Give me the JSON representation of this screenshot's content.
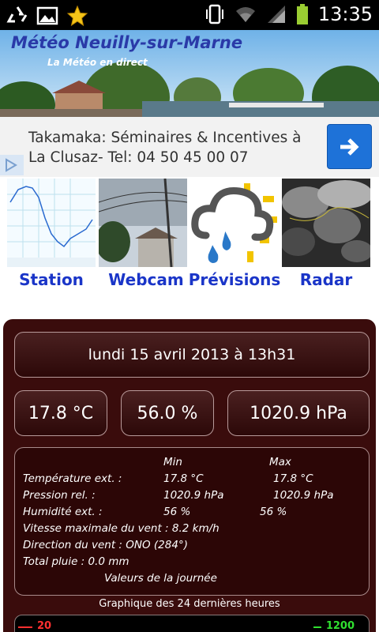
{
  "status_bar": {
    "time": "13:35",
    "left_icons": [
      "recycle-icon",
      "image-icon",
      "star-icon"
    ],
    "right_icons": [
      "vibrate-icon",
      "wifi-icon",
      "signal-icon",
      "battery-icon"
    ]
  },
  "header": {
    "title": "Météo Neuilly-sur-Marne",
    "subtitle": "La Météo en direct"
  },
  "ad": {
    "text": "Takamaka: Séminaires & Incentives à La Clusaz- Tel: 04 50 45 00 07",
    "button_icon": "arrow-right-icon",
    "colors": {
      "button": "#1e72d8",
      "background": "#f2f2f2"
    }
  },
  "nav": {
    "items": [
      {
        "label": "Station",
        "icon": "station-chart-thumbnail"
      },
      {
        "label": "Webcam",
        "icon": "webcam-thumbnail"
      },
      {
        "label": "Prévisions",
        "icon": "forecast-cloud-thumbnail"
      },
      {
        "label": "Radar",
        "icon": "radar-thumbnail"
      }
    ],
    "colors": {
      "label": "#1a35c8"
    }
  },
  "weather": {
    "date": "lundi 15 avril 2013 à 13h31",
    "temperature": "17.8 °C",
    "humidity": "56.0 %",
    "pressure": "1020.9 hPa",
    "details": {
      "col_min": "Min",
      "col_max": "Max",
      "rows": [
        {
          "label": "Température ext. :",
          "min": "17.8 °C",
          "max": "17.8 °C"
        },
        {
          "label": "Pression rel. :",
          "min": "1020.9 hPa",
          "max": "1020.9 hPa"
        },
        {
          "label": "Humidité ext. :",
          "min": "56 %",
          "max": "56 %"
        }
      ],
      "wind_max": "Vitesse maximale du vent : 8.2 km/h",
      "wind_dir": "Direction du vent : ONO (284°)",
      "rain": "Total pluie : 0.0 mm",
      "footer": "Valeurs de la journée"
    },
    "graph_title": "Graphique des 24 dernières heures",
    "graph_left_label": "20",
    "graph_right_label": "1200",
    "colors": {
      "panel": "#3a0c0c",
      "graph_left": "#ff3030",
      "graph_right": "#30e030"
    }
  }
}
